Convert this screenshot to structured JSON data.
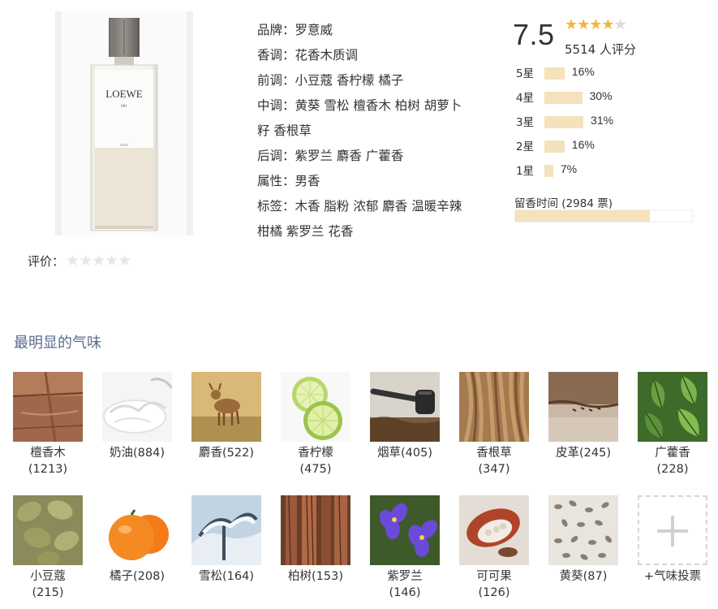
{
  "product": {
    "bottle_brand_text": "LOEWE",
    "bottle_sub_text": "001",
    "bottle_small_text": "MAN"
  },
  "user_rating": {
    "label": "评价：",
    "stars": 5
  },
  "attributes": [
    {
      "text": "品牌：罗意威"
    },
    {
      "text": "香调：花香木质调"
    },
    {
      "text": "前调：小豆蔻 香柠檬 橘子"
    },
    {
      "text": "中调：黄葵 雪松 檀香木 柏树 胡萝卜"
    },
    {
      "text": "籽 香根草"
    },
    {
      "text": "后调：紫罗兰 麝香 广藿香"
    },
    {
      "text": "属性：男香"
    },
    {
      "text": "标签：木香 脂粉 浓郁 麝香 温暖辛辣"
    },
    {
      "text": "柑橘 紫罗兰 花香"
    }
  ],
  "score": {
    "value": "7.5",
    "stars_filled": 4,
    "stars_total": 5,
    "count_text": "5514 人评分",
    "accent_color": "#f2b63c",
    "bar_color": "#f5e2bc"
  },
  "distribution": [
    {
      "label": "5星",
      "pct_text": "16%",
      "pct": 16
    },
    {
      "label": "4星",
      "pct_text": "30%",
      "pct": 30
    },
    {
      "label": "3星",
      "pct_text": "31%",
      "pct": 31
    },
    {
      "label": "2星",
      "pct_text": "16%",
      "pct": 16
    },
    {
      "label": "1星",
      "pct_text": "7%",
      "pct": 7
    }
  ],
  "longevity": {
    "label": "留香时间 (2984 票)",
    "fill": 0.76
  },
  "section": {
    "title": "最明显的气味"
  },
  "notes": [
    {
      "line1": "檀香木",
      "line2": "(1213)",
      "icon": "sandalwood-image"
    },
    {
      "line1": "奶油(884)",
      "line2": "",
      "icon": "cream-image"
    },
    {
      "line1": "麝香(522)",
      "line2": "",
      "icon": "musk-deer-image"
    },
    {
      "line1": "香柠檬",
      "line2": "(475)",
      "icon": "bergamot-image"
    },
    {
      "line1": "烟草(405)",
      "line2": "",
      "icon": "tobacco-pipe-image"
    },
    {
      "line1": "香根草",
      "line2": "(347)",
      "icon": "vetiver-roots-image"
    },
    {
      "line1": "皮革(245)",
      "line2": "",
      "icon": "leather-image"
    },
    {
      "line1": "广藿香",
      "line2": "(228)",
      "icon": "patchouli-leaves-image"
    },
    {
      "line1": "小豆蔻",
      "line2": "(215)",
      "icon": "cardamom-image"
    },
    {
      "line1": "橘子(208)",
      "line2": "",
      "icon": "mandarin-image"
    },
    {
      "line1": "雪松(164)",
      "line2": "",
      "icon": "cedar-snow-image"
    },
    {
      "line1": "柏树(153)",
      "line2": "",
      "icon": "cypress-trunks-image"
    },
    {
      "line1": "紫罗兰",
      "line2": "(146)",
      "icon": "violet-flowers-image"
    },
    {
      "line1": "可可果",
      "line2": "(126)",
      "icon": "cocoa-pod-image"
    },
    {
      "line1": "黄葵(87)",
      "line2": "",
      "icon": "ambrette-seeds-image"
    }
  ],
  "vote": {
    "label": "+气味投票",
    "icon": "plus-icon"
  }
}
